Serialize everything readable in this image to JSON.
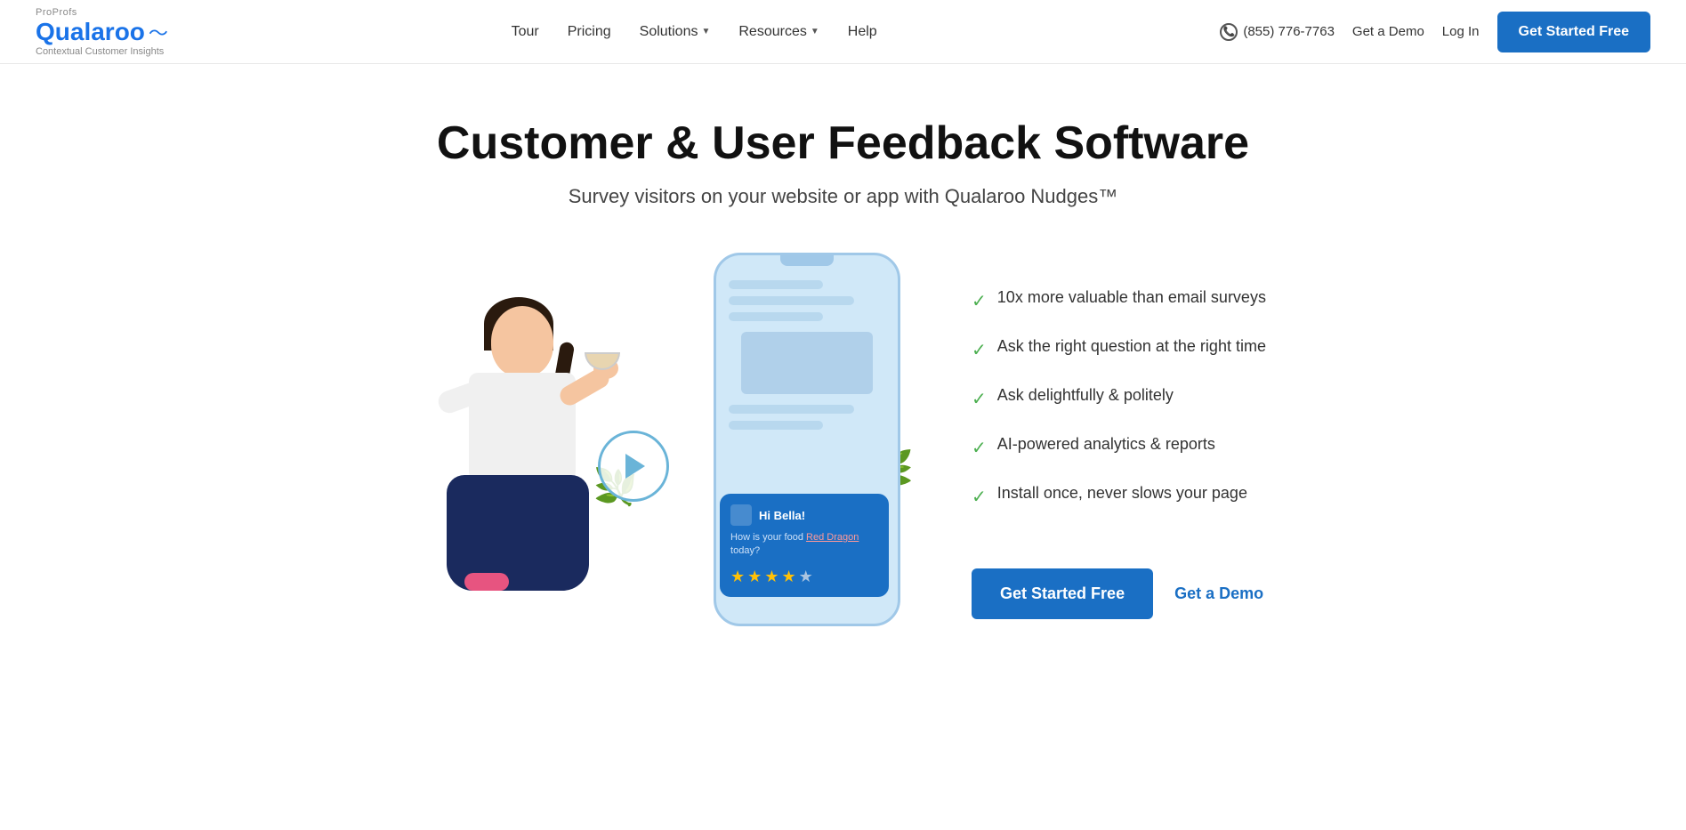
{
  "brand": {
    "proprofs_label": "ProProfs",
    "logo_text": "Qualaroo",
    "logo_sub": "Contextual Customer Insights"
  },
  "nav": {
    "tour_label": "Tour",
    "pricing_label": "Pricing",
    "solutions_label": "Solutions",
    "resources_label": "Resources",
    "help_label": "Help"
  },
  "header": {
    "phone": "(855) 776-7763",
    "get_demo_label": "Get a Demo",
    "login_label": "Log In",
    "cta_label": "Get Started Free"
  },
  "hero": {
    "title": "Customer & User Feedback Software",
    "subtitle": "Survey visitors on your website or app with Qualaroo Nudges™"
  },
  "features": [
    {
      "text": "10x more valuable than email surveys"
    },
    {
      "text": "Ask the right question at the right time"
    },
    {
      "text": "Ask delightfully & politely"
    },
    {
      "text": "AI-powered analytics & reports"
    },
    {
      "text": "Install once, never slows your page"
    }
  ],
  "survey_card": {
    "greeting": "Hi Bella!",
    "question_prefix": "How is your food",
    "question_link": "Red Dragon",
    "question_suffix": "today?",
    "stars_filled": 4,
    "stars_total": 5
  },
  "cta": {
    "primary_label": "Get Started Free",
    "secondary_label": "Get a Demo"
  }
}
